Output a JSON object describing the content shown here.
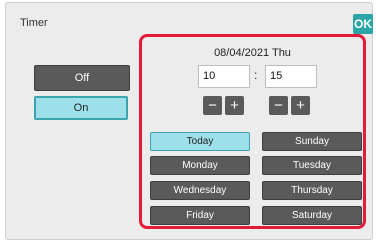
{
  "window": {
    "title": "Timer",
    "ok_label": "OK"
  },
  "mode": {
    "off_label": "Off",
    "on_label": "On",
    "selected": "On"
  },
  "timer": {
    "date_text": "08/04/2021 Thu",
    "hour_value": "10",
    "minute_value": "15",
    "separator": ":",
    "minus_symbol": "−",
    "plus_symbol": "+"
  },
  "days": [
    {
      "label": "Today",
      "active": true
    },
    {
      "label": "Sunday",
      "active": false
    },
    {
      "label": "Monday",
      "active": false
    },
    {
      "label": "Tuesday",
      "active": false
    },
    {
      "label": "Wednesday",
      "active": false
    },
    {
      "label": "Thursday",
      "active": false
    },
    {
      "label": "Friday",
      "active": false
    },
    {
      "label": "Saturday",
      "active": false
    }
  ],
  "colors": {
    "accent": "#2aa6a6",
    "highlight_border": "#e21b3b",
    "selected_bg": "#9ee0ea"
  }
}
